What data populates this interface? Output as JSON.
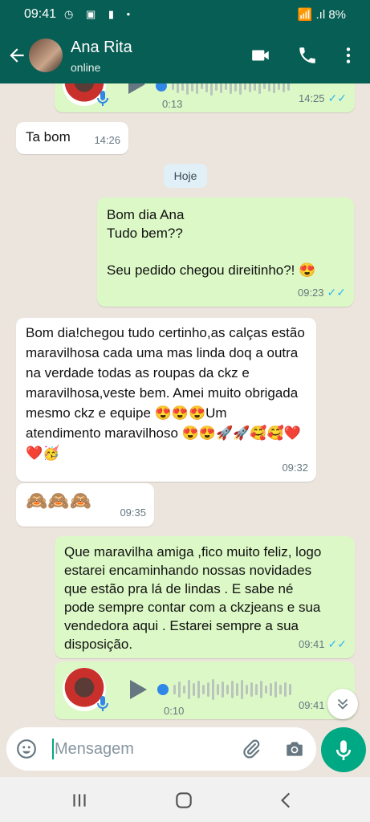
{
  "status": {
    "time": "09:41",
    "left_icons": "◷ ▣ ▮ •",
    "right_icons": "📶 .ıl 8%"
  },
  "header": {
    "name": "Ana Rita",
    "presence": "online"
  },
  "messages": {
    "audio_top": {
      "duration": "0:13",
      "time": "14:25"
    },
    "ta_bom": {
      "text": "Ta bom",
      "time": "14:26"
    },
    "day": "Hoje",
    "bom_dia": {
      "text": "Bom dia Ana\nTudo bem??\n\nSeu pedido chegou direitinho?! 😍",
      "time": "09:23"
    },
    "reply": {
      "text": "Bom dia!chegou tudo certinho,as calças estão maravilhosa cada uma mas linda doq a outra na verdade todas as roupas da ckz e maravilhosa,veste bem. Amei muito obrigada mesmo ckz e equipe 😍😍😍Um atendimento maravilhoso 😍😍🚀🚀🥰🥰❤️❤️🥳",
      "time": "09:32"
    },
    "monkeys": {
      "text": "🙈🙈🙈",
      "time": "09:35"
    },
    "maravilha": {
      "text": "Que maravilha amiga ,fico muito feliz, logo estarei encaminhando nossas novidades que estão pra lá de lindas . E sabe né pode sempre contar com a ckzjeans e sua vendedora aqui . Estarei sempre a sua disposição.",
      "time": "09:41"
    },
    "audio_bottom": {
      "duration": "0:10",
      "time": "09:41"
    }
  },
  "composer": {
    "placeholder": "Mensagem"
  },
  "colors": {
    "header": "#075e54",
    "outgoing": "#dcf8c6",
    "incoming": "#ffffff",
    "accent": "#00a884",
    "read_ticks": "#34b7f1"
  },
  "icons": [
    "back-arrow-icon",
    "video-call-icon",
    "phone-icon",
    "more-vert-icon",
    "emoji-icon",
    "attach-icon",
    "camera-icon",
    "mic-icon",
    "play-icon",
    "chevrons-down-icon",
    "nav-recents-icon",
    "nav-home-icon",
    "nav-back-icon"
  ]
}
